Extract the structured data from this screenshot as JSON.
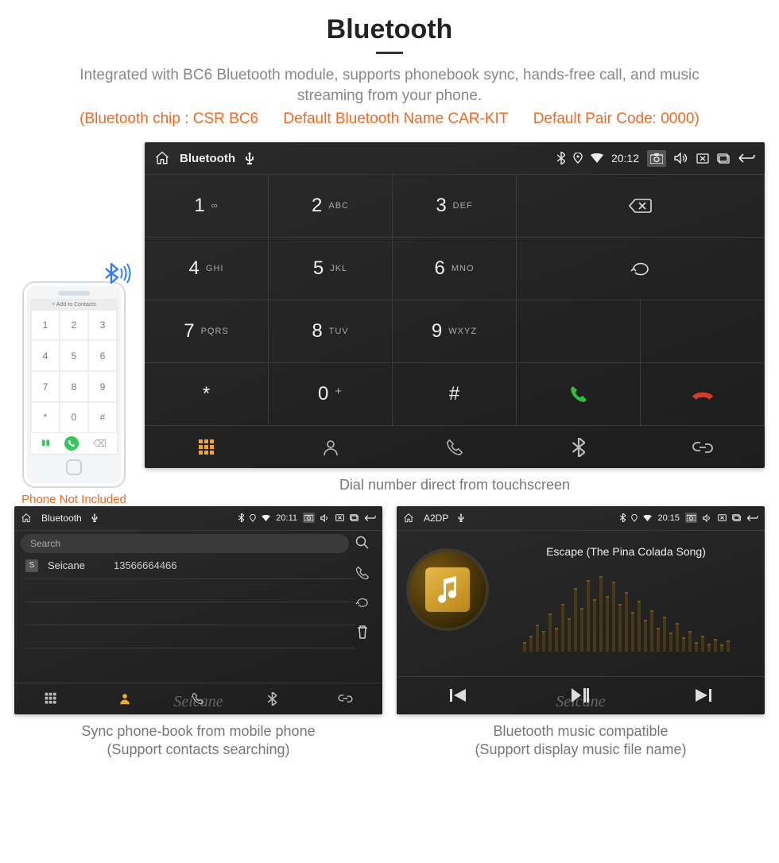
{
  "heading": {
    "title": "Bluetooth",
    "description": "Integrated with BC6 Bluetooth module, supports phonebook sync, hands-free call, and music streaming from your phone.",
    "note_chip": "(Bluetooth chip : CSR BC6",
    "note_name": "Default Bluetooth Name CAR-KIT",
    "note_code": "Default Pair Code: 0000)"
  },
  "phone_mock": {
    "topbar": "+  Add to Contacts",
    "keys": [
      "1",
      "2",
      "3",
      "4",
      "5",
      "6",
      "7",
      "8",
      "9",
      "*",
      "0",
      "#"
    ],
    "caption": "Phone Not Included"
  },
  "dialer": {
    "status": {
      "title": "Bluetooth",
      "time": "20:12"
    },
    "keys": [
      {
        "digit": "1",
        "sub": "∞"
      },
      {
        "digit": "2",
        "sub": "ABC"
      },
      {
        "digit": "3",
        "sub": "DEF"
      },
      {
        "digit": "4",
        "sub": "GHI"
      },
      {
        "digit": "5",
        "sub": "JKL"
      },
      {
        "digit": "6",
        "sub": "MNO"
      },
      {
        "digit": "7",
        "sub": "PQRS"
      },
      {
        "digit": "8",
        "sub": "TUV"
      },
      {
        "digit": "9",
        "sub": "WXYZ"
      },
      {
        "digit": "*",
        "sub": ""
      },
      {
        "digit": "0",
        "sub": "+"
      },
      {
        "digit": "#",
        "sub": ""
      }
    ],
    "caption": "Dial number direct from touchscreen"
  },
  "phonebook": {
    "status": {
      "title": "Bluetooth",
      "time": "20:11"
    },
    "search_placeholder": "Search",
    "contact": {
      "letter": "S",
      "name": "Seicane",
      "number": "13566664466"
    },
    "caption_line1": "Sync phone-book from mobile phone",
    "caption_line2": "(Support contacts searching)"
  },
  "a2dp": {
    "status": {
      "title": "A2DP",
      "time": "20:15"
    },
    "track": "Escape (The Pina Colada Song)",
    "caption_line1": "Bluetooth music compatible",
    "caption_line2": "(Support display music file name)",
    "watermark": "Seicane"
  }
}
